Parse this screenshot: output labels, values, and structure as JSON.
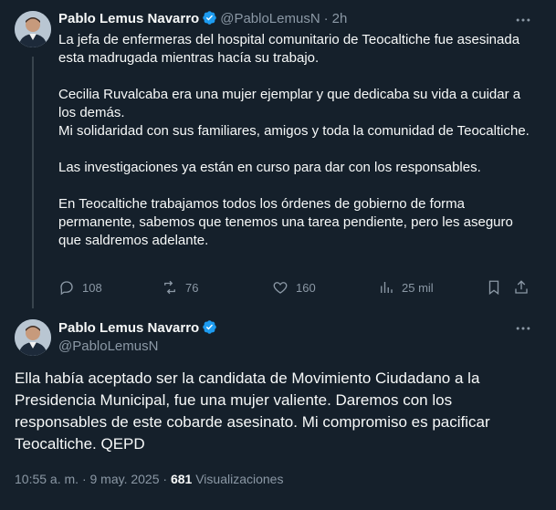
{
  "tweet1": {
    "author_name": "Pablo Lemus Navarro",
    "author_handle": "@PabloLemusN",
    "separator": "·",
    "time_ago": "2h",
    "paragraphs": [
      "La jefa de enfermeras del hospital comunitario de Teocaltiche fue asesinada esta madrugada mientras hacía su trabajo.",
      "Cecilia Ruvalcaba era una mujer ejemplar y que dedicaba su vida a cuidar a los demás.",
      "Mi solidaridad con sus familiares, amigos y toda la comunidad de Teocaltiche.",
      "Las investigaciones ya están en curso para dar con los responsables.",
      "En Teocaltiche trabajamos todos los órdenes de gobierno de forma permanente, sabemos que tenemos una tarea pendiente, pero les aseguro que saldremos adelante."
    ],
    "actions": {
      "replies": "108",
      "reposts": "76",
      "likes": "160",
      "views": "25 mil"
    }
  },
  "tweet2": {
    "author_name": "Pablo Lemus Navarro",
    "author_handle": "@PabloLemusN",
    "text": "Ella había aceptado ser la candidata de Movimiento Ciudadano a la Presidencia Municipal, fue una mujer valiente. Daremos con los responsables de este cobarde asesinato. Mi compromiso es pacificar Teocaltiche. QEPD",
    "time": "10:55 a. m.",
    "date_separator": "·",
    "date": "9 may. 2025",
    "views_separator": "·",
    "view_count": "681",
    "views_label": "Visualizaciones"
  },
  "colors": {
    "background": "#15202b",
    "primary_text": "#f7f9f9",
    "secondary_text": "#8b98a5",
    "verified_badge": "#1d9bf0",
    "thread_line": "#38444d"
  },
  "icons": [
    "avatar",
    "verified-badge-icon",
    "more-options-icon",
    "reply-icon",
    "repost-icon",
    "like-icon",
    "views-icon",
    "bookmark-icon",
    "share-icon"
  ]
}
